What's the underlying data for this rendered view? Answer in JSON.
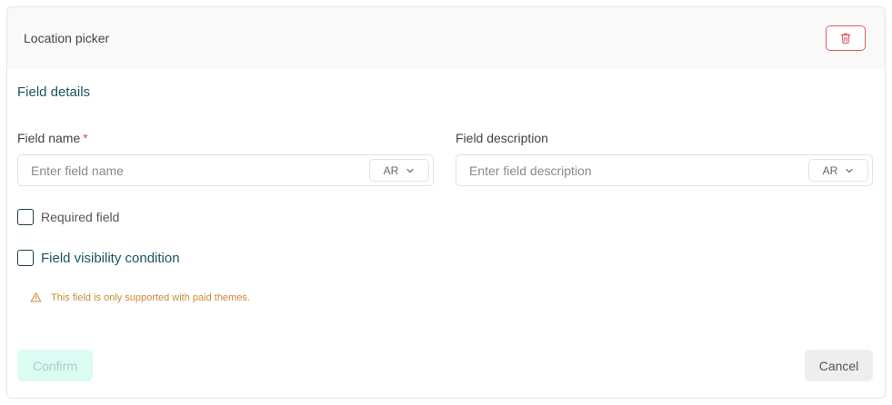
{
  "header": {
    "title": "Location picker"
  },
  "section": {
    "title": "Field details"
  },
  "field_name": {
    "label": "Field name",
    "required_marker": "*",
    "placeholder": "Enter field name",
    "lang": "AR"
  },
  "field_description": {
    "label": "Field description",
    "placeholder": "Enter field description",
    "lang": "AR"
  },
  "options": {
    "required_label": "Required field",
    "visibility_label": "Field visibility condition"
  },
  "warning": {
    "text": "This field is only supported with paid themes.",
    "color": "#cc8a3a"
  },
  "footer": {
    "confirm_label": "Confirm",
    "cancel_label": "Cancel"
  },
  "colors": {
    "accent": "#1a5560",
    "danger": "#e15b5b",
    "confirm_bg": "#dcfbf3"
  },
  "icons": {
    "delete": "trash-icon",
    "lang_dropdown": "chevron-down-icon",
    "warning": "warning-triangle-icon"
  }
}
